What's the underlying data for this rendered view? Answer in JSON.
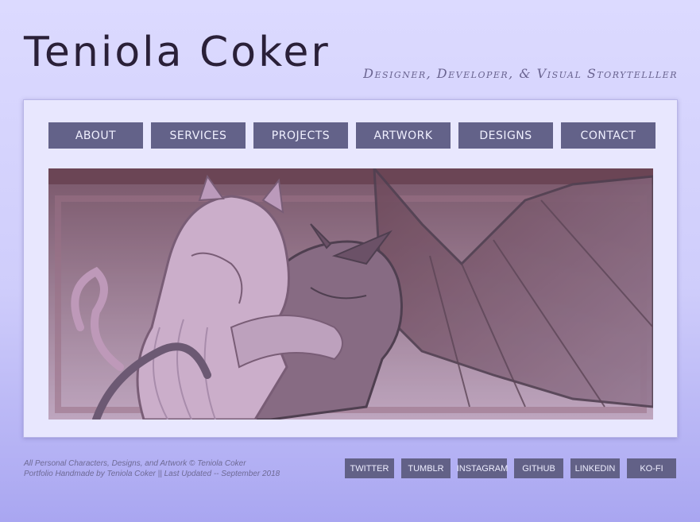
{
  "header": {
    "title": "Teniola Coker",
    "tagline": "Designer, Developer, & Visual Storytelller"
  },
  "nav": {
    "items": [
      {
        "label": "ABOUT"
      },
      {
        "label": "SERVICES"
      },
      {
        "label": "PROJECTS"
      },
      {
        "label": "ARTWORK"
      },
      {
        "label": "DESIGNS"
      },
      {
        "label": "CONTACT"
      }
    ]
  },
  "hero": {
    "colors": {
      "frame": "#5a3844",
      "bg_top": "#6d4757",
      "bg_bottom": "#b79bb3",
      "line": "#3d2a3a"
    }
  },
  "footer": {
    "line1": "All Personal Characters, Designs, and Artwork © Teniola Coker",
    "line2": "Portfolio Handmade by Teniola Coker || Last Updated -- September 2018",
    "social": [
      {
        "label": "TWITTER"
      },
      {
        "label": "TUMBLR"
      },
      {
        "label": "INSTAGRAM"
      },
      {
        "label": "GITHUB"
      },
      {
        "label": "LINKEDIN"
      },
      {
        "label": "KO-FI"
      }
    ]
  },
  "colors": {
    "accent": "#636289",
    "panel": "#e8e7fe",
    "title": "#2a2038",
    "tagline": "#6a6490"
  }
}
